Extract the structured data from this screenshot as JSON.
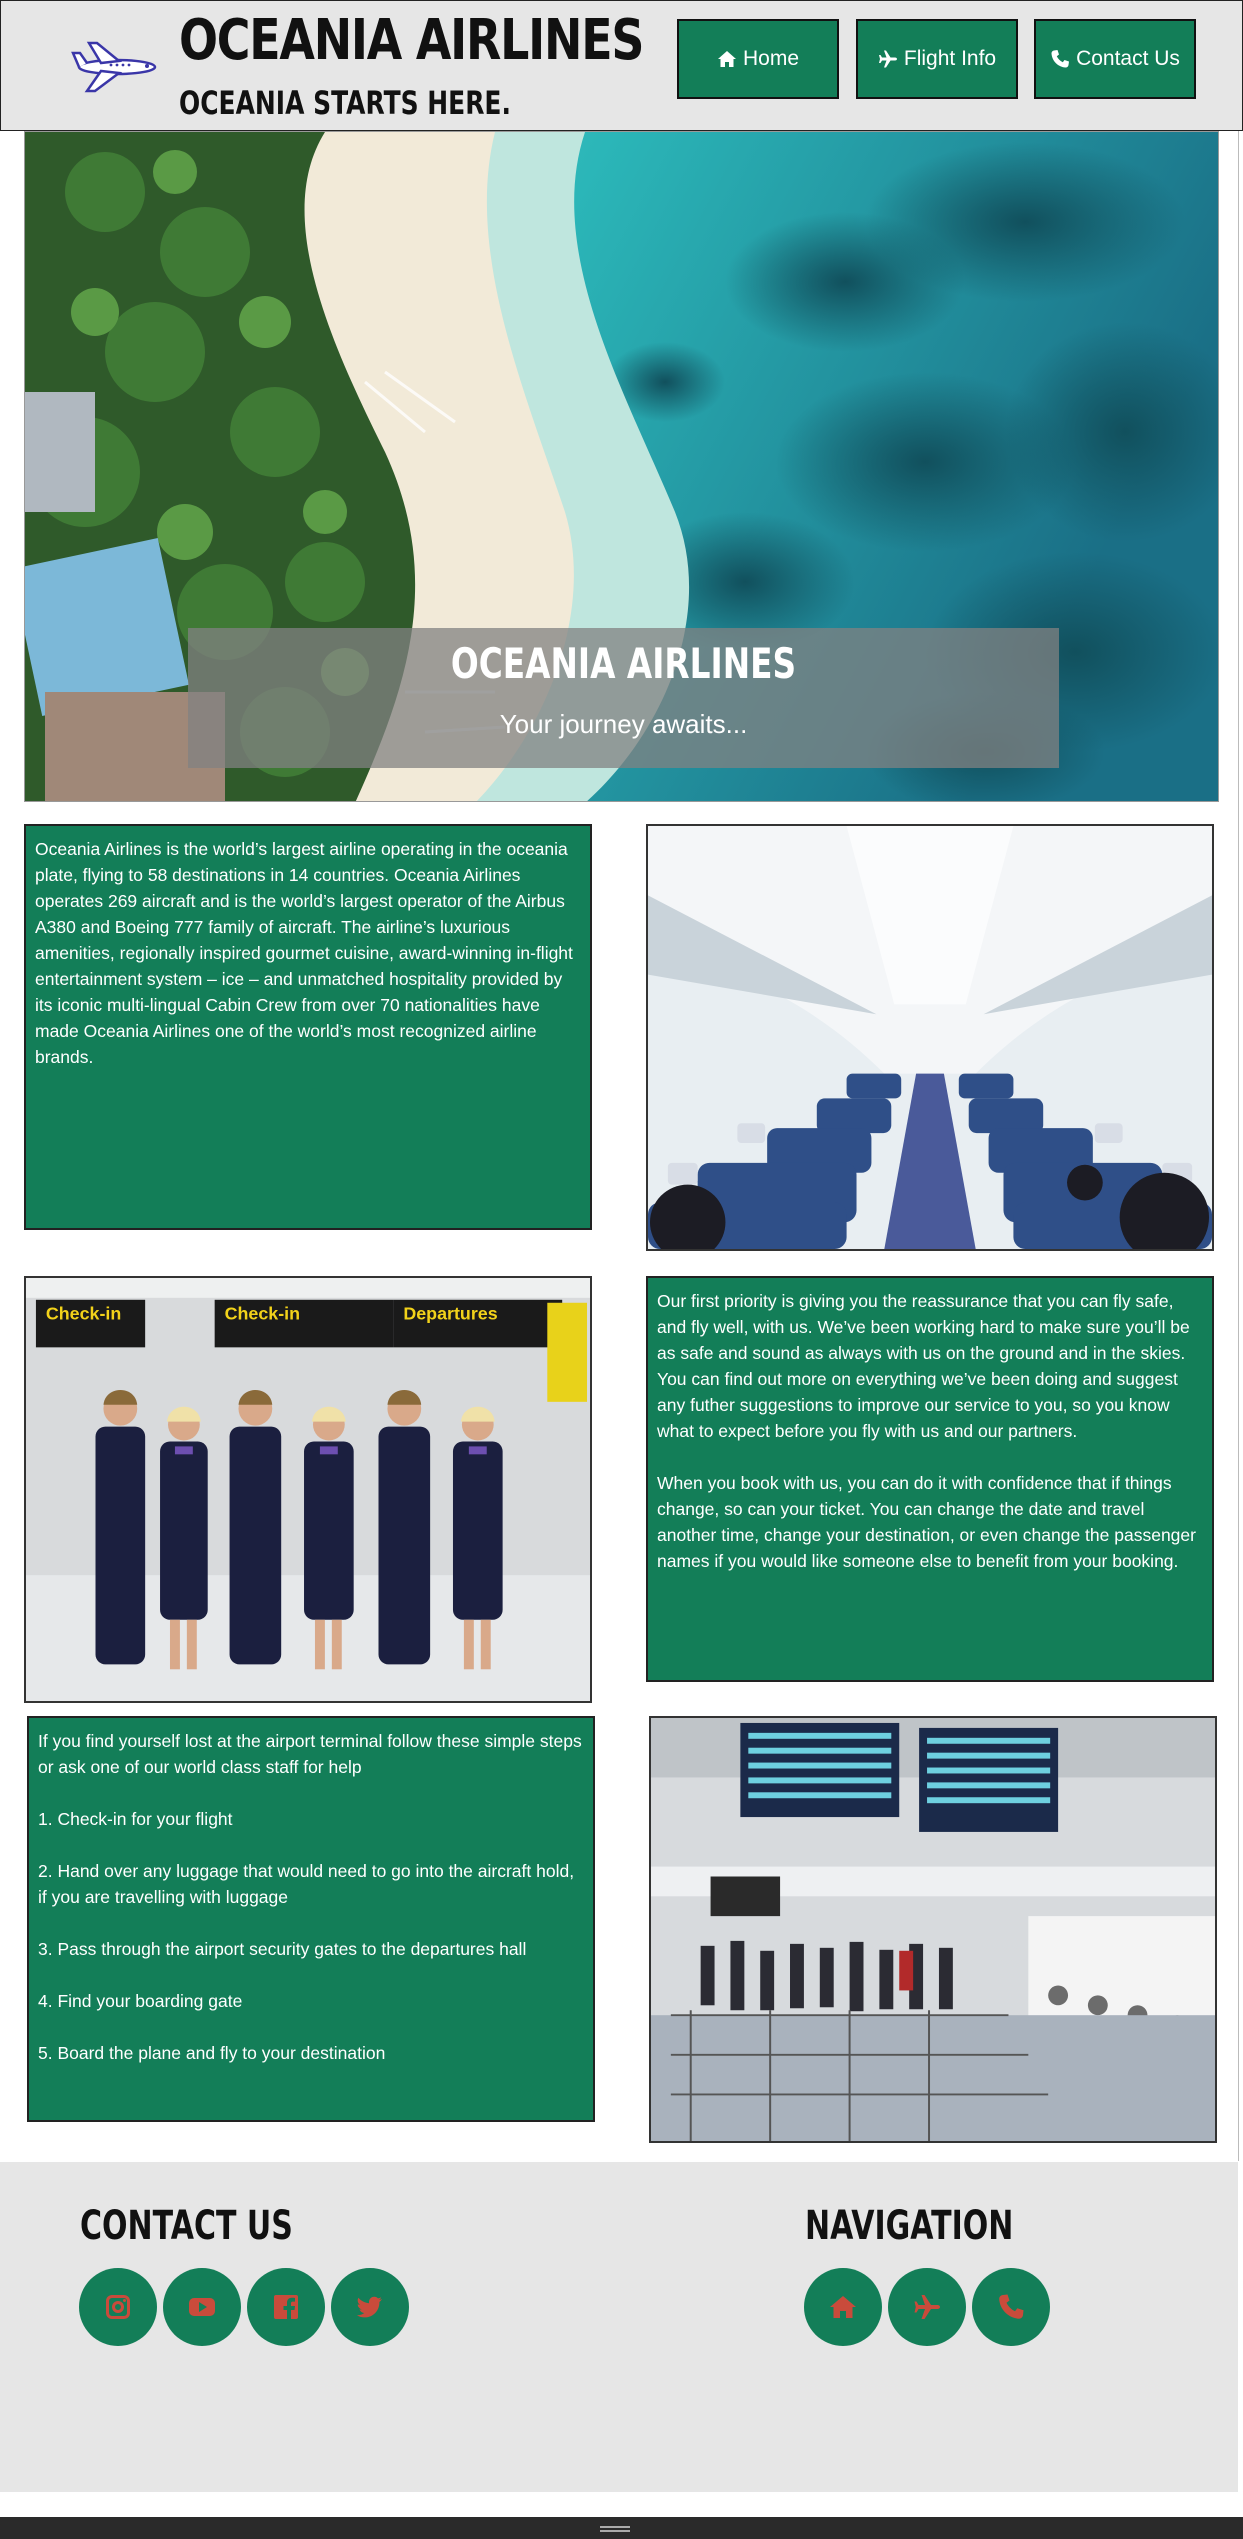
{
  "header": {
    "logo_icon": "airplane-logo-icon",
    "title": "OCEANIA AIRLINES",
    "tagline": "OCEANIA STARTS HERE.",
    "nav": [
      {
        "label": "Home",
        "icon": "home-icon"
      },
      {
        "label": "Flight Info",
        "icon": "plane-icon"
      },
      {
        "label": "Contact Us",
        "icon": "phone-icon"
      }
    ]
  },
  "hero": {
    "title": "OCEANIA AIRLINES",
    "subtitle": "Your journey awaits..."
  },
  "sections": {
    "about": "Oceania Airlines is the world’s largest airline operating in the oceania plate, flying to 58 destinations in 14 countries. Oceania Airlines operates 269 aircraft and is the world’s largest operator of the Airbus A380 and Boeing 777 family of aircraft. The airline’s luxurious amenities, regionally inspired gourmet cuisine, award-winning in-flight entertainment system – ice – and unmatched hospitality provided by its iconic multi-lingual Cabin Crew from over 70 nationalities have made Oceania Airlines one of the world’s most recognized airline brands.",
    "safety": [
      "Our first priority is giving you the reassurance that you can fly safe, and fly well, with us. We’ve been working hard to make sure you’ll be as safe and sound as always with us on the ground and in the skies. You can find out more on everything we’ve been doing and suggest any futher suggestions to improve our service to you, so you know what to expect before you fly with us and our partners.",
      "When you book with us, you can do it with confidence that if things change, so can your ticket. You can change the date and travel another time, change your destination, or even change the passenger names if you would like someone else to benefit from your booking."
    ],
    "steps": [
      "If you find yourself lost at the airport terminal follow these simple steps or ask one of our world class staff for help",
      "1. Check-in for your flight",
      "2. Hand over any luggage that would need to go into the aircraft hold, if you are travelling with luggage",
      "3. Pass through the airport security gates to the departures hall",
      "4. Find your boarding gate",
      "5. Board the plane and fly to your destination"
    ]
  },
  "photos": {
    "cabin": "aircraft-cabin-photo",
    "crew": "cabin-crew-photo",
    "terminal": "airport-terminal-photo",
    "crew_signs": [
      "Check-in",
      "Check-in",
      "Departures"
    ]
  },
  "footer": {
    "contact_title": "CONTACT US",
    "navigation_title": "NAVIGATION",
    "social": [
      "instagram-icon",
      "youtube-icon",
      "facebook-icon",
      "twitter-icon"
    ],
    "nav_icons": [
      "home-icon",
      "plane-icon",
      "phone-icon"
    ]
  },
  "colors": {
    "primary_green": "#137e58",
    "icon_red": "#c94b3b",
    "header_bg": "#e6e6e6"
  }
}
